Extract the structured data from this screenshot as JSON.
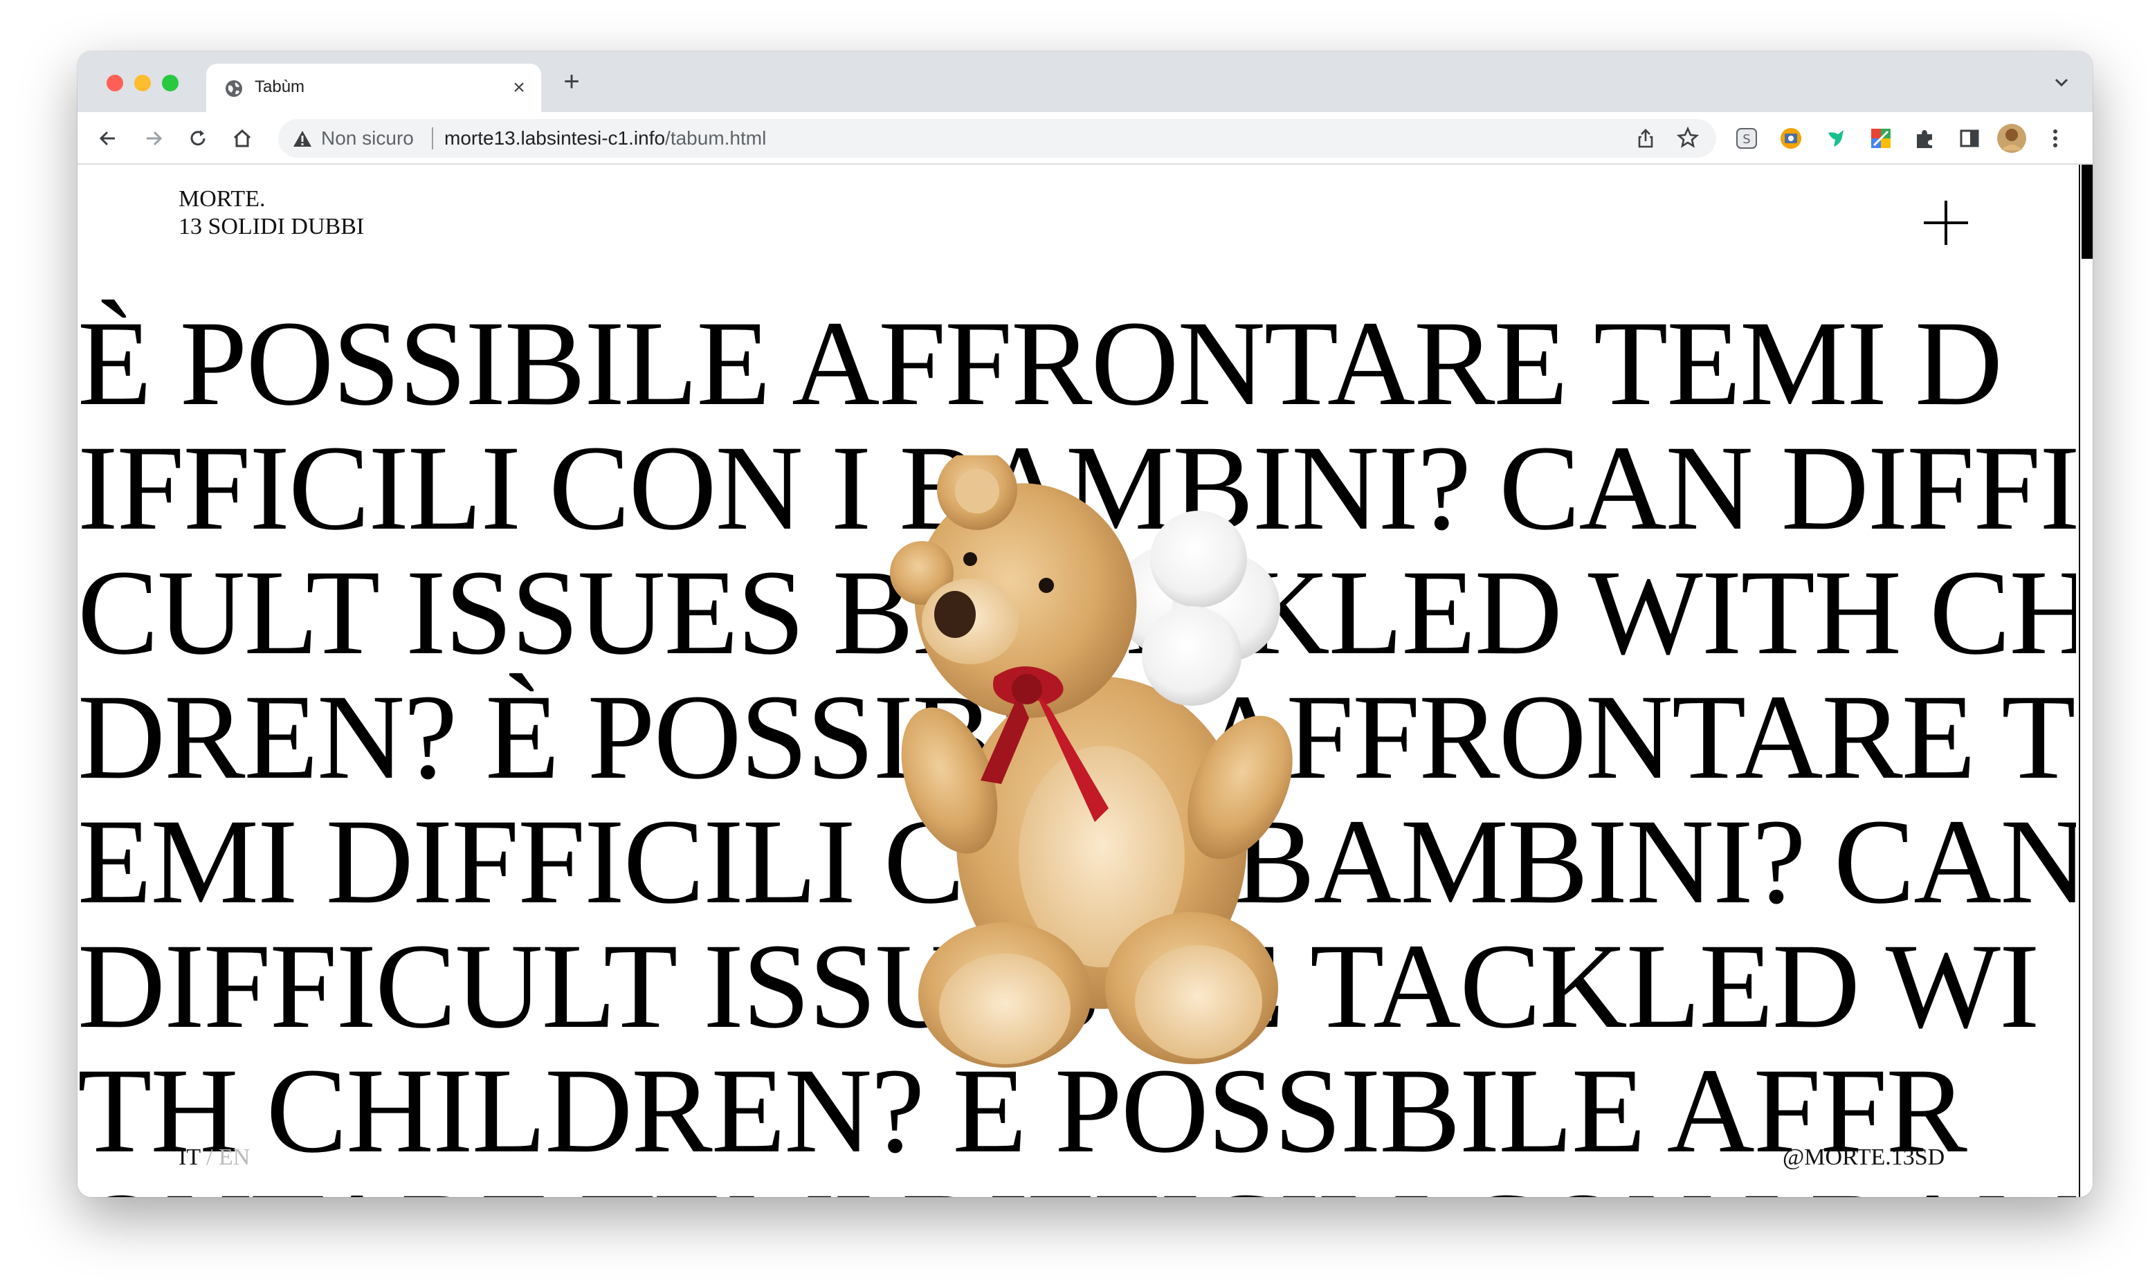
{
  "browser": {
    "tab": {
      "title": "Tabùm",
      "close_label": "×"
    },
    "new_tab_label": "+",
    "omnibox": {
      "security_label": "Non sicuro",
      "domain": "morte13.labsintesi-c1.info",
      "path": "/tabum.html"
    },
    "toolbar_icons": [
      "back-arrow-icon",
      "forward-arrow-icon",
      "reload-icon",
      "home-icon",
      "share-icon",
      "bookmark-star-icon",
      "extension-s-icon",
      "extension-camera-icon",
      "extension-bird-icon",
      "extension-color-icon",
      "extensions-puzzle-icon",
      "side-panel-icon",
      "profile-avatar",
      "kebab-menu-icon"
    ]
  },
  "site": {
    "brand_line1": "MORTE.",
    "brand_line2": "13 SOLIDI DUBBI",
    "menu_icon": "plus-icon",
    "headline_lines": [
      "È POSSIBILE AFFRONTARE TEMI D",
      "IFFICILI CON I BAMBINI? CAN DIFFI",
      "CULT ISSUES BE TACKLED WITH CHIL",
      "DREN? È POSSIBILE AFFRONTARE T",
      "EMI DIFFICILI CON I BAMBINI? CAN",
      "DIFFICULT ISSUES BE TACKLED WI",
      "TH CHILDREN? È POSSIBILE AFFR",
      "ONTARE TEMI DIFFICILI CON I BAM"
    ],
    "footer": {
      "lang_it": "IT",
      "lang_sep": " / ",
      "lang_en": "EN",
      "handle": "@MORTE.13SD"
    },
    "image": "teddy-bear-with-cotton"
  }
}
